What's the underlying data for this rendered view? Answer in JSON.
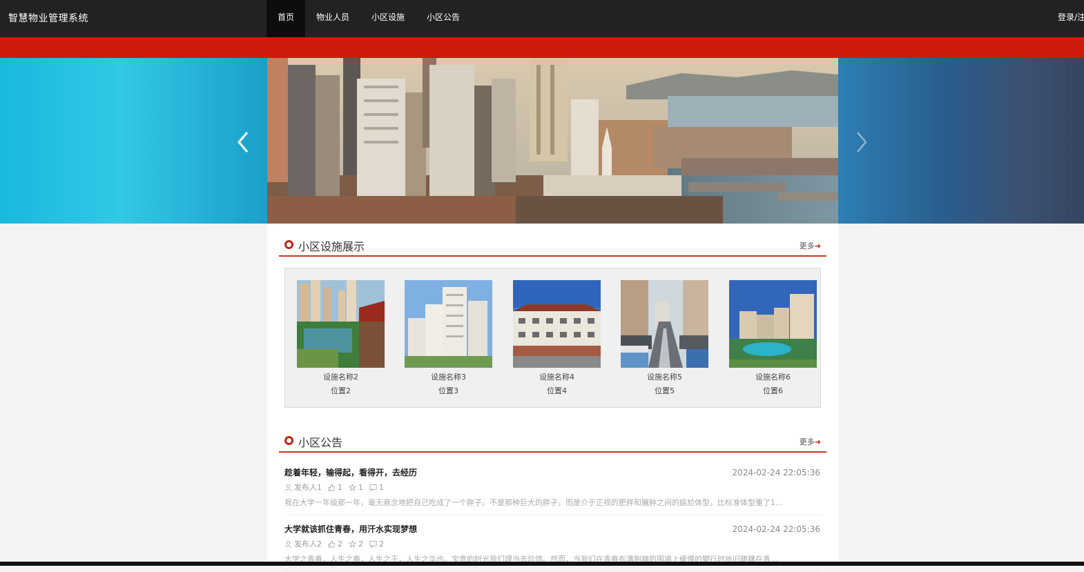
{
  "app": {
    "title": "智慧物业管理系统"
  },
  "nav": {
    "items": [
      {
        "label": "首页",
        "active": true
      },
      {
        "label": "物业人员",
        "active": false
      },
      {
        "label": "小区设施",
        "active": false
      },
      {
        "label": "小区公告",
        "active": false
      }
    ],
    "login_label": "登录/注"
  },
  "colors": {
    "topbar": "#222222",
    "accent_red": "#d01a0c",
    "section_line": "#c23a1e"
  },
  "banner": {
    "prev_icon": "chevron-left-icon",
    "next_icon": "chevron-right-icon"
  },
  "facilities": {
    "title": "小区设施展示",
    "more_label": "更多",
    "items": [
      {
        "name": "设施名称2",
        "location": "位置2"
      },
      {
        "name": "设施名称3",
        "location": "位置3"
      },
      {
        "name": "设施名称4",
        "location": "位置4"
      },
      {
        "name": "设施名称5",
        "location": "位置5"
      },
      {
        "name": "设施名称6",
        "location": "位置6"
      }
    ]
  },
  "notices": {
    "title": "小区公告",
    "more_label": "更多",
    "items": [
      {
        "title": "趁着年轻，输得起，看得开，去经历",
        "date": "2024-02-24 22:05:36",
        "author": "发布人1",
        "likes": "1",
        "favorites": "1",
        "comments": "1",
        "excerpt": "我在大学一年级那一年，毫无悬念地把自己吃成了一个胖子。不是那种巨大的胖子，而是介于正视的肥胖和臃肿之间的尴尬体型，比标准体型重了1..."
      },
      {
        "title": "大学就该抓住青春，用汗水实现梦想",
        "date": "2024-02-24 22:05:36",
        "author": "发布人2",
        "likes": "2",
        "favorites": "2",
        "comments": "2",
        "excerpt": "大学之青春，人生之春，人生之王，人生之华也。宝贵的时光我们理当去珍惜。然而，当我们在青春布满荆棘的围墙上缓慢的攀行时依旧踌躇在青..."
      }
    ]
  }
}
